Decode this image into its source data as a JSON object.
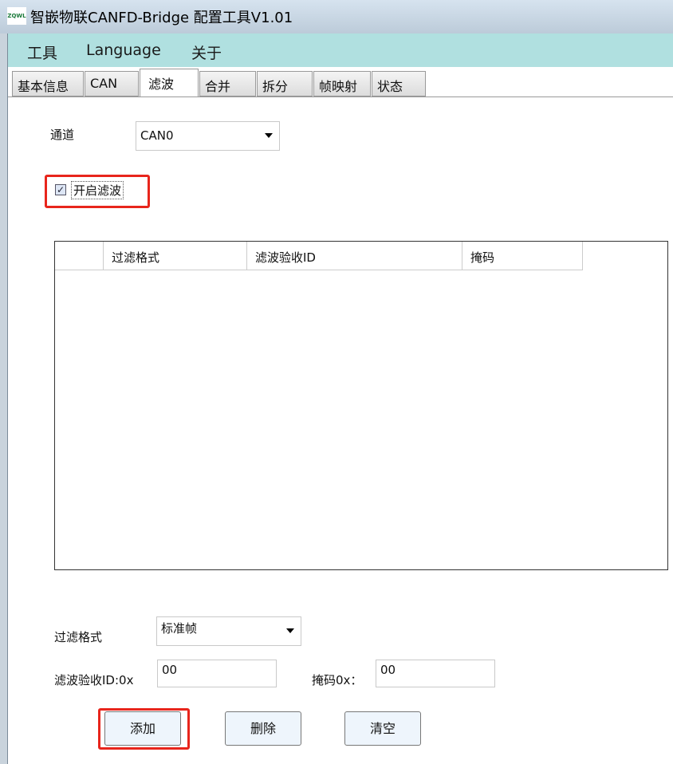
{
  "window": {
    "title": "智嵌物联CANFD-Bridge 配置工具V1.01",
    "logo_text": "ZQWL"
  },
  "menu": [
    "工具",
    "Language",
    "关于"
  ],
  "tabs": [
    "基本信息",
    "CAN",
    "滤波",
    "合并",
    "拆分",
    "帧映射",
    "状态"
  ],
  "active_tab": "滤波",
  "filter": {
    "channel_label": "通道",
    "channel_value": "CAN0",
    "enable_label": "开启滤波",
    "enable_checked": true,
    "table_columns": [
      "过滤格式",
      "滤波验收ID",
      "掩码"
    ],
    "rows": [],
    "format_label": "过滤格式",
    "format_value": "标准帧",
    "id_label": "滤波验收ID:0x",
    "id_value": "00",
    "mask_label": "掩码0x：",
    "mask_value": "00",
    "buttons": {
      "add": "添加",
      "delete": "删除",
      "clear": "清空"
    },
    "highlight_color": "#e8251c"
  }
}
